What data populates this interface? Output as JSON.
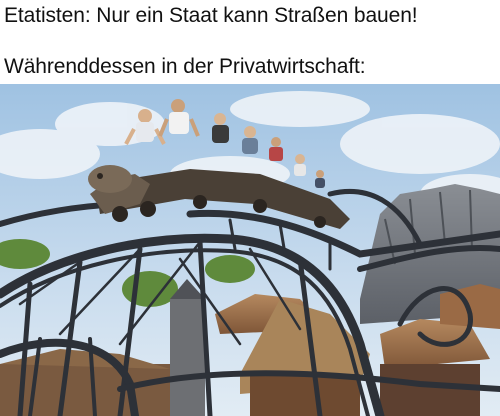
{
  "meme": {
    "top_text": "Etatisten: Nur ein Staat kann Straßen bauen!",
    "bottom_text": "Währenddessen in der Privatwirtschaft:"
  },
  "photo": {
    "subject": "roller-coaster-photo",
    "colors": {
      "sky": "#b9d3ea",
      "steel": "#2d3138",
      "roof": "#a0704a",
      "foliage": "#5f8a3c"
    }
  }
}
